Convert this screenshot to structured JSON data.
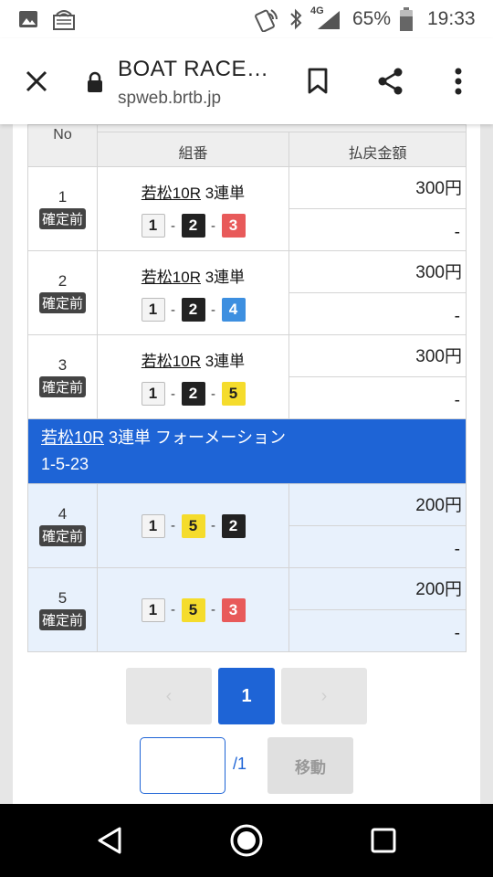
{
  "status_bar": {
    "network": "4G",
    "battery": "65%",
    "time": "19:33",
    "icons": [
      "image-icon",
      "wifi-sim-icon",
      "nfc-icon",
      "bluetooth-icon",
      "signal-icon",
      "battery-icon"
    ]
  },
  "browser": {
    "title": "BOAT RACE…",
    "url": "spweb.brtb.jp",
    "icons": [
      "close-icon",
      "lock-icon",
      "bookmark-icon",
      "share-icon",
      "more-vert-icon"
    ]
  },
  "table": {
    "headers": {
      "no": "No",
      "combo": "組番",
      "payout": "払戻金額"
    },
    "status_label": "確定前",
    "rows": [
      {
        "no": "1",
        "race": "若松10R",
        "bet": "3連単",
        "boats": [
          "1",
          "2",
          "3"
        ],
        "payout_top": "300円",
        "payout_bottom": "-"
      },
      {
        "no": "2",
        "race": "若松10R",
        "bet": "3連単",
        "boats": [
          "1",
          "2",
          "4"
        ],
        "payout_top": "300円",
        "payout_bottom": "-"
      },
      {
        "no": "3",
        "race": "若松10R",
        "bet": "3連単",
        "boats": [
          "1",
          "2",
          "5"
        ],
        "payout_top": "300円",
        "payout_bottom": "-"
      }
    ],
    "formation": {
      "race": "若松10R",
      "text": "3連単 フォーメーション",
      "combo": "1-5-23"
    },
    "formation_rows": [
      {
        "no": "4",
        "boats": [
          "1",
          "5",
          "2"
        ],
        "payout_top": "200円",
        "payout_bottom": "-"
      },
      {
        "no": "5",
        "boats": [
          "1",
          "5",
          "3"
        ],
        "payout_top": "200円",
        "payout_bottom": "-"
      }
    ]
  },
  "pagination": {
    "prev": "‹",
    "current": "1",
    "next": "›",
    "input_value": "",
    "total": "/1",
    "go": "移動"
  },
  "colors": {
    "accent": "#1e64d6",
    "boat1": "#f4f4f4",
    "boat2": "#222222",
    "boat3": "#e85a5a",
    "boat4": "#3d8fe0",
    "boat5": "#f5dc2c"
  }
}
